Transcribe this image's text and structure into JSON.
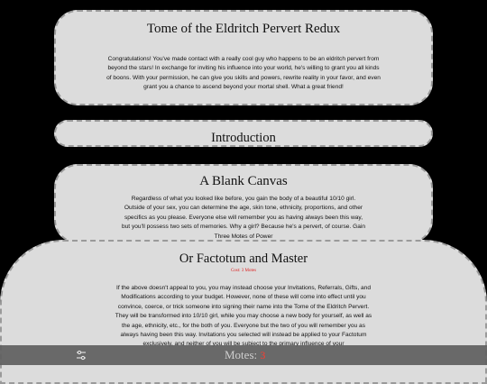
{
  "cards": {
    "title": {
      "heading": "Tome of the Eldritch Pervert Redux",
      "body": "Congratulations! You've made contact with a really cool guy who happens to be an eldritch pervert from beyond the stars! In exchange for inviting his influence into your world, he's willing to grant you all kinds of boons. With your permission, he can give you skills and powers, rewrite reality in your favor, and even grant you a chance to ascend beyond your mortal shell. What a great friend!"
    },
    "intro": {
      "heading": "Introduction"
    },
    "blank_canvas": {
      "heading": "A Blank Canvas",
      "body": "Regardless of what you looked like before, you gain the body of a beautiful 10/10 girl. Outside of your sex, you can determine the age, skin tone, ethnicity, proportions, and other specifics as you please. Everyone else will remember you as having always been this way, but you'll possess two sets of memories. Why a girl? Because he's a pervert, of course. Gain Three Motes of Power"
    },
    "factotum": {
      "heading": "Or Factotum and Master",
      "cost": "Cost: 3 Motes",
      "body": "If the above doesn't appeal to you, you may instead choose your Invitations, Referrals, Gifts, and Modifications according to your budget. However, none of these will come into effect until you convince, coerce, or trick someone into signing their name into the Tome of the Eldritch Pervert. They will be transformed into 10/10 girl, while you may choose a new body for yourself, as well as the age, ethnicity, etc., for the both of you. Everyone but the two of you will remember you as always having been this way. Invitations you selected will instead be applied to your Factotum exclusively, and neither of you will be subject to the primary influence of your"
    }
  },
  "bottom_bar": {
    "motes_label": "Motes:",
    "motes_value": "3"
  },
  "colors": {
    "card_background": "#dcdcdc",
    "page_background": "#000000",
    "cost_text": "#dd2222",
    "motes_value": "#ff3b2f"
  },
  "icons": {
    "settings": "sliders-icon"
  }
}
